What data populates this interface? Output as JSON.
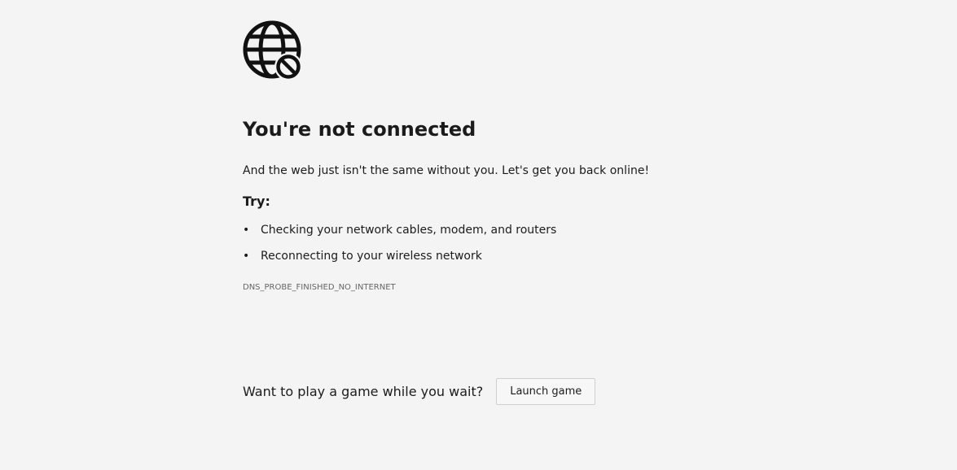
{
  "header": {
    "icon": "globe-blocked-icon",
    "title": "You're not connected",
    "subtitle": "And the web just isn't the same without you. Let's get you back online!"
  },
  "suggestions": {
    "heading": "Try:",
    "bullet": "•",
    "items": [
      "Checking your network cables, modem, and routers",
      "Reconnecting to your wireless network"
    ]
  },
  "error_code": "DNS_PROBE_FINISHED_NO_INTERNET",
  "game": {
    "prompt": "Want to play a game while you wait?",
    "button_label": "Launch game"
  },
  "colors": {
    "background": "#f4f4f4",
    "text": "#1b1b1b",
    "muted_text": "#666666"
  }
}
